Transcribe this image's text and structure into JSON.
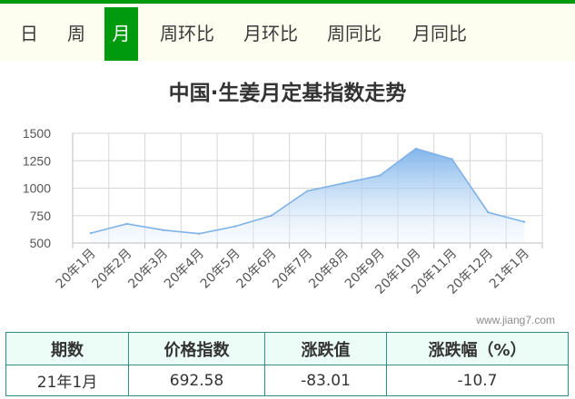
{
  "tabs": [
    {
      "label": "日",
      "active": false
    },
    {
      "label": "周",
      "active": false
    },
    {
      "label": "月",
      "active": true
    },
    {
      "label": "周环比",
      "active": false
    },
    {
      "label": "月环比",
      "active": false
    },
    {
      "label": "周同比",
      "active": false
    },
    {
      "label": "月同比",
      "active": false
    }
  ],
  "watermark": "www.jiang7.com",
  "colors": {
    "accent": "#009a0f",
    "line": "#7fb2e6",
    "area_top": "#7ab1ea",
    "area_bottom": "#eef5fd",
    "table_border": "#2f8f8a",
    "table_header_bg": "#ecfdf7"
  },
  "chart_data": {
    "type": "area",
    "title": "中国·生姜月定基指数走势",
    "categories": [
      "20年1月",
      "20年2月",
      "20年3月",
      "20年4月",
      "20年5月",
      "20年6月",
      "20年7月",
      "20年8月",
      "20年9月",
      "20年10月",
      "20年11月",
      "20年12月",
      "21年1月"
    ],
    "series": [
      {
        "values": [
          590,
          675,
          618,
          585,
          652,
          750,
          975,
          1045,
          1115,
          1360,
          1265,
          780,
          693
        ]
      }
    ],
    "yticks": [
      500,
      750,
      1000,
      1250,
      1500
    ],
    "ylim": [
      500,
      1500
    ],
    "grid": true,
    "legend": "none"
  },
  "table": {
    "headers": [
      "期数",
      "价格指数",
      "涨跌值",
      "涨跌幅（%）"
    ],
    "rows": [
      [
        "21年1月",
        "692.58",
        "-83.01",
        "-10.7"
      ]
    ]
  }
}
